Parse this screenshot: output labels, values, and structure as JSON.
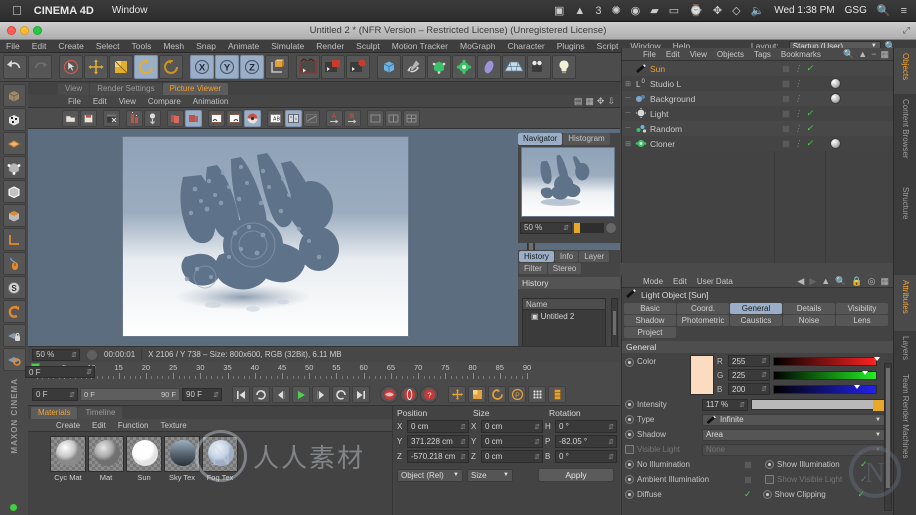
{
  "os_menubar": {
    "apple_icon": "apple-icon",
    "app_name": "CINEMA 4D",
    "menus": [
      "Window"
    ],
    "status_icons": [
      "screen-record-icon",
      "activity-icon",
      "dropbox-icon",
      "eyedropper-icon",
      "battery-icon",
      "airplay-icon",
      "timemachine-icon",
      "bluetooth-icon",
      "wifi-icon",
      "volume-icon"
    ],
    "activity_count": "3",
    "clock": "Wed 1:38 PM",
    "user": "GSG",
    "search_icon": "search-icon",
    "list_icon": "notifications-icon"
  },
  "window": {
    "title": "Untitled 2 * (NFR Version – Restricted License) (Unregistered License)",
    "expand_icon": "expand-icon"
  },
  "main_menu": {
    "items": [
      "File",
      "Edit",
      "Create",
      "Select",
      "Tools",
      "Mesh",
      "Snap",
      "Animate",
      "Simulate",
      "Render",
      "Sculpt",
      "Motion Tracker",
      "MoGraph",
      "Character",
      "Plugins",
      "Script",
      "Window",
      "Help"
    ],
    "layout_label": "Layout:",
    "layout_value": "Startup (User)"
  },
  "toolbar": {
    "icons": [
      {
        "name": "undo-icon",
        "selected": false
      },
      {
        "name": "redo-icon",
        "selected": false
      },
      {
        "name": "live-selection-icon",
        "selected": false
      },
      {
        "name": "move-icon",
        "selected": false
      },
      {
        "name": "scale-icon",
        "selected": false
      },
      {
        "name": "rotate-icon",
        "selected": true
      },
      {
        "name": "rotate-alt-icon",
        "selected": false
      },
      {
        "name": "axis-x-icon",
        "selected": true,
        "label": "X"
      },
      {
        "name": "axis-y-icon",
        "selected": true,
        "label": "Y"
      },
      {
        "name": "axis-z-icon",
        "selected": true,
        "label": "Z"
      },
      {
        "name": "world-coordinate-icon",
        "selected": false
      },
      {
        "name": "render-view-icon",
        "selected": false
      },
      {
        "name": "render-region-icon",
        "selected": false
      },
      {
        "name": "render-settings-icon",
        "selected": false
      },
      {
        "name": "primitive-cube-icon",
        "selected": false
      },
      {
        "name": "spline-pen-icon",
        "selected": false
      },
      {
        "name": "generator-icon",
        "selected": false
      },
      {
        "name": "deformer-icon",
        "selected": false
      },
      {
        "name": "environment-icon",
        "selected": false
      },
      {
        "name": "floor-icon",
        "selected": false
      },
      {
        "name": "camera-icon",
        "selected": false
      },
      {
        "name": "light-icon",
        "selected": false
      }
    ]
  },
  "picture_viewer": {
    "tabs": [
      {
        "label": "View",
        "active": false
      },
      {
        "label": "Render Settings",
        "active": false
      },
      {
        "label": "Picture Viewer",
        "active": true
      }
    ],
    "menu": [
      "File",
      "Edit",
      "View",
      "Compare",
      "Animation"
    ],
    "toolbar_icons": [
      "open-image-icon",
      "save-image-icon",
      "render-queue-icon",
      "compare-ab-icon",
      "save-frame-icon",
      "layers-icon",
      "history-icon",
      "show-left-icon",
      "show-right-icon",
      "render-icon",
      "ab-compare-icon",
      "split-view-icon",
      "ab-diff-icon",
      "set-a-icon",
      "set-b-icon",
      "view-single-icon",
      "view-dual-icon",
      "view-quad-icon"
    ]
  },
  "navigator": {
    "tabs": [
      {
        "label": "Navigator",
        "active": true
      },
      {
        "label": "Histogram",
        "active": false
      }
    ],
    "zoom": "50 %"
  },
  "history_panel": {
    "tabs": [
      {
        "label": "History",
        "active": true
      },
      {
        "label": "Info",
        "active": false
      },
      {
        "label": "Layer",
        "active": false
      },
      {
        "label": "Filter",
        "active": false
      },
      {
        "label": "Stereo",
        "active": false
      }
    ],
    "section_title": "History",
    "column_header": "Name",
    "rows": [
      "Untitled 2"
    ]
  },
  "status_bar": {
    "zoom": "50 %",
    "time": "00:00:01",
    "info": "X 2106 / Y 738 – Size: 800x600, RGB (32Bit), 6.11 MB"
  },
  "timeline": {
    "ticks": [
      0,
      5,
      10,
      15,
      20,
      25,
      30,
      35,
      40,
      45,
      50,
      55,
      60,
      65,
      70,
      75,
      80,
      85,
      90
    ],
    "current_field": "0 F",
    "current_frame_marker": 0
  },
  "transport": {
    "current_frame": "0 F",
    "range_start": "0 F",
    "range_end": "90 F",
    "end_frame": "90 F",
    "buttons": [
      "go-to-start-icon",
      "play-reverse-loop-icon",
      "step-back-icon",
      "play-icon",
      "step-forward-icon",
      "loop-icon",
      "go-to-end-icon",
      "record-active-objects-icon",
      "autokey-icon",
      "keyframe-selection-icon",
      "position-key-icon",
      "scale-key-icon",
      "rotation-key-icon",
      "parameter-key-icon",
      "point-level-key-icon",
      "timeline-icon"
    ]
  },
  "materials": {
    "tabs": [
      {
        "label": "Materials",
        "active": true
      },
      {
        "label": "Timeline",
        "active": false
      }
    ],
    "menu": [
      "Create",
      "Edit",
      "Function",
      "Texture"
    ],
    "items": [
      {
        "label": "Cyc Mat",
        "color": "#d8d8d8"
      },
      {
        "label": "Mat",
        "color": "#b8b8b8"
      },
      {
        "label": "Sun",
        "color": "#fdfdfd"
      },
      {
        "label": "Sky Tex",
        "color": "#6d7b88"
      },
      {
        "label": "Fog Tex",
        "color": "#c9d4e2"
      }
    ]
  },
  "coordinates": {
    "headers": [
      "Position",
      "Size",
      "Rotation"
    ],
    "rows": [
      {
        "axis": "X",
        "position": "0 cm",
        "size_axis": "X",
        "size": "0 cm",
        "rot_axis": "H",
        "rotation": "0 °"
      },
      {
        "axis": "Y",
        "position": "371.228 cm",
        "size_axis": "Y",
        "size": "0 cm",
        "rot_axis": "P",
        "rotation": "-82.05 °"
      },
      {
        "axis": "Z",
        "position": "-570.218 cm",
        "size_axis": "Z",
        "size": "0 cm",
        "rot_axis": "B",
        "rotation": "0 °"
      }
    ],
    "mode": "Object (Rel)",
    "size_mode": "Size",
    "apply_label": "Apply"
  },
  "left_toolbar": {
    "icons": [
      "model-mode-icon",
      "texture-mode-icon",
      "polygon-mode-icon",
      "points-mode-icon",
      "edges-mode-icon",
      "polygons-mode-icon",
      "axis-mode-icon",
      "enable-axis-icon",
      "soft-selection-icon",
      "viewport-solo-icon",
      "workplane-lock-icon",
      "workplane-icon"
    ],
    "brand": "MAXON CINEMA"
  },
  "objects_manager": {
    "menu": [
      "File",
      "Edit",
      "View",
      "Objects",
      "Tags",
      "Bookmarks"
    ],
    "menu_icons": [
      "search-icon",
      "home-icon",
      "minus-icon",
      "layout-icon"
    ],
    "items": [
      {
        "name": "Sun",
        "icon": "sun-light-icon",
        "selected": true,
        "expandable": false,
        "visible_check": true,
        "has_tag": false
      },
      {
        "name": "Studio L",
        "icon": "layer-zero-icon",
        "selected": false,
        "expandable": true,
        "visible_check": false,
        "has_tag": true
      },
      {
        "name": "Background",
        "icon": "background-icon",
        "selected": false,
        "expandable": false,
        "visible_check": false,
        "has_tag": true
      },
      {
        "name": "Light",
        "icon": "light-object-icon",
        "selected": false,
        "expandable": false,
        "visible_check": true,
        "has_tag": false
      },
      {
        "name": "Random",
        "icon": "random-effector-icon",
        "selected": false,
        "expandable": false,
        "visible_check": true,
        "has_tag": false
      },
      {
        "name": "Cloner",
        "icon": "cloner-icon",
        "selected": false,
        "expandable": true,
        "visible_check": true,
        "has_tag": true
      }
    ]
  },
  "attributes": {
    "menu": [
      "Mode",
      "Edit",
      "User Data"
    ],
    "nav_icons": [
      "back-arrow-icon",
      "forward-arrow-icon",
      "up-arrow-icon",
      "search-icon",
      "lock-icon",
      "link-icon",
      "layout-icon"
    ],
    "object_icon": "light-object-icon",
    "object_title": "Light Object [Sun]",
    "tabs": [
      {
        "label": "Basic",
        "active": false
      },
      {
        "label": "Coord.",
        "active": false
      },
      {
        "label": "General",
        "active": true
      },
      {
        "label": "Details",
        "active": false
      },
      {
        "label": "Visibility",
        "active": false
      },
      {
        "label": "Shadow",
        "active": false
      },
      {
        "label": "Photometric",
        "active": false
      },
      {
        "label": "Caustics",
        "active": false
      },
      {
        "label": "Noise",
        "active": false
      },
      {
        "label": "Lens",
        "active": false
      },
      {
        "label": "Project",
        "active": false
      }
    ],
    "section": "General",
    "color_label": "Color",
    "color_swatch": "#fbdcc0",
    "channels": [
      {
        "label": "R",
        "value": "255",
        "pos": 98
      },
      {
        "label": "G",
        "value": "225",
        "pos": 86
      },
      {
        "label": "B",
        "value": "200",
        "pos": 78
      }
    ],
    "fields": [
      {
        "label": "Intensity",
        "value": "117 %",
        "type": "slider"
      },
      {
        "label": "Type",
        "value": "Infinite",
        "type": "dropdown"
      },
      {
        "label": "Shadow",
        "value": "Area",
        "type": "dropdown"
      },
      {
        "label": "Visible Light",
        "value": "None",
        "type": "dropdown",
        "disabled": true
      }
    ],
    "checkboxes_left": [
      {
        "label": "No Illumination",
        "checked": false,
        "disabled": false
      },
      {
        "label": "Ambient Illumination",
        "checked": false,
        "disabled": false
      },
      {
        "label": "Diffuse",
        "checked": true,
        "disabled": false
      }
    ],
    "checkboxes_right": [
      {
        "label": "Show Illumination",
        "checked": true,
        "disabled": false
      },
      {
        "label": "Show Visible Light",
        "checked": true,
        "disabled": true
      },
      {
        "label": "Show Clipping",
        "checked": true,
        "disabled": false
      }
    ]
  },
  "vertical_tabs_right": [
    {
      "label": "Objects",
      "active": true
    },
    {
      "label": "Content Browser",
      "active": false
    },
    {
      "label": "Structure",
      "active": false
    },
    {
      "label": "Attributes",
      "active": true
    },
    {
      "label": "Layers",
      "active": false
    },
    {
      "label": "Team Render Machines",
      "active": false
    }
  ],
  "watermark": {
    "text": "人人素材",
    "logo": "N"
  }
}
